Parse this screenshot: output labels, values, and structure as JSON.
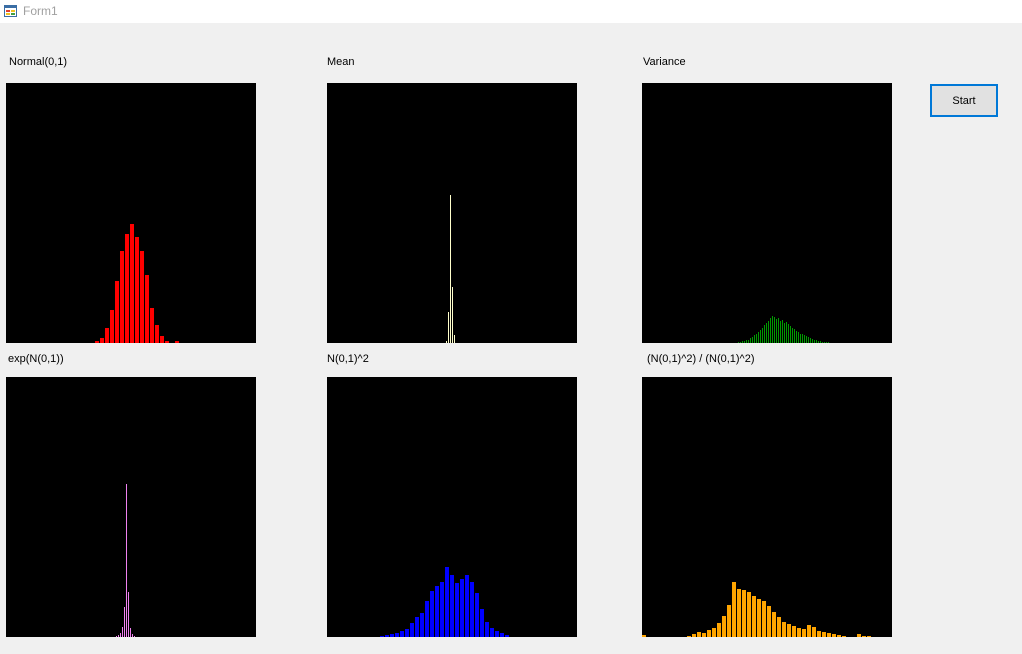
{
  "window": {
    "title": "Form1"
  },
  "labels": {
    "normal": "Normal(0,1)",
    "mean": "Mean",
    "variance": "Variance",
    "exp": "exp(N(0,1))",
    "square": "N(0,1)^2",
    "ratio": "(N(0,1)^2) / (N(0,1)^2)"
  },
  "buttons": {
    "start": "Start"
  },
  "chart_data": [
    {
      "type": "bar",
      "title": "Normal(0,1)",
      "color": "#ff0000",
      "xlabel": "",
      "ylabel": "",
      "values": [
        1,
        0,
        0,
        0,
        0,
        0,
        0,
        0,
        0,
        0,
        0,
        0,
        0,
        0,
        0,
        0,
        0,
        0,
        0,
        0,
        0,
        0,
        0,
        0,
        0,
        0,
        0,
        0,
        0,
        0,
        0,
        0,
        0,
        0,
        0,
        0,
        0,
        0,
        0,
        0,
        0,
        0,
        0,
        0,
        0,
        0,
        0,
        0,
        0,
        0,
        0,
        0,
        0,
        0,
        0,
        0,
        0,
        0,
        0,
        0,
        0,
        0,
        0,
        0,
        0,
        0,
        0,
        0,
        0,
        0,
        0,
        0,
        0,
        0,
        0,
        0,
        0,
        0,
        0,
        0,
        0,
        0,
        0,
        0,
        0,
        0,
        0,
        0,
        0,
        0,
        0,
        0,
        0,
        0,
        0,
        0,
        0,
        0,
        0,
        0,
        0,
        0,
        0,
        0,
        0,
        0,
        0,
        0,
        0,
        0,
        0,
        0,
        0,
        0,
        0,
        0,
        0,
        0,
        0,
        0,
        0,
        0,
        0,
        0,
        0,
        0,
        0,
        0,
        0,
        0,
        0,
        0,
        0,
        0,
        0,
        0,
        0,
        0,
        0,
        0,
        0,
        0,
        0,
        0,
        0,
        0,
        0,
        0,
        0,
        0,
        0,
        0,
        0,
        0,
        0,
        0,
        0,
        0,
        0,
        0,
        0,
        0,
        0,
        0,
        0,
        0,
        0,
        0,
        0,
        0,
        0,
        0,
        0,
        0,
        0,
        0,
        0,
        0,
        0,
        0,
        0,
        0,
        0,
        0,
        0,
        0,
        0,
        0,
        0,
        0,
        0,
        0,
        0,
        0,
        0,
        0,
        0,
        0,
        0,
        0,
        0,
        0,
        0,
        0,
        0,
        0,
        0,
        0,
        0,
        0,
        0,
        0,
        0,
        0,
        0,
        0,
        0,
        0,
        0,
        0,
        0,
        0,
        0,
        0,
        0,
        0,
        0,
        0,
        0,
        0,
        0,
        0,
        0,
        0,
        0,
        0,
        0,
        0,
        0,
        0,
        0,
        0,
        0,
        0,
        0,
        0,
        0,
        0,
        0,
        0,
        0,
        0,
        0,
        0,
        0,
        0,
        0,
        0,
        0,
        0,
        0,
        0,
        0
      ]
    },
    {
      "type": "bar",
      "title": "Mean",
      "color": "#ffffcc",
      "xlabel": "",
      "ylabel": "",
      "values": []
    },
    {
      "type": "bar",
      "title": "Variance",
      "color": "#009900",
      "xlabel": "",
      "ylabel": "",
      "values": []
    },
    {
      "type": "bar",
      "title": "exp(N(0,1))",
      "color": "#ee82ee",
      "xlabel": "",
      "ylabel": "",
      "values": []
    },
    {
      "type": "bar",
      "title": "N(0,1)^2",
      "color": "#0000ff",
      "xlabel": "",
      "ylabel": "",
      "values": []
    },
    {
      "type": "bar",
      "title": "(N(0,1)^2) / (N(0,1)^2)",
      "color": "#ffa500",
      "xlabel": "",
      "ylabel": "",
      "values": []
    }
  ]
}
